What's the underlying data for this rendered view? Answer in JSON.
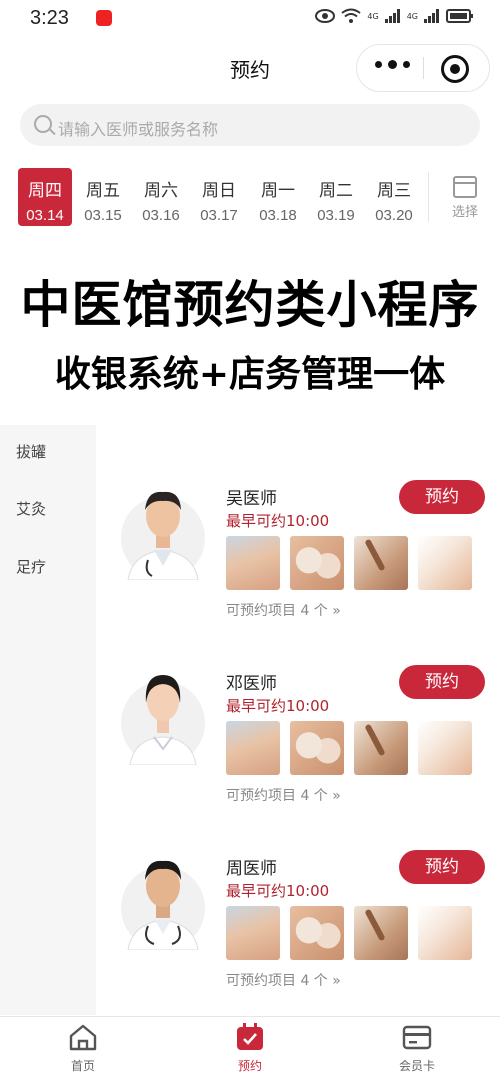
{
  "status_bar": {
    "time": "3:23",
    "signal_label_1": "4G",
    "signal_label_2": "4G"
  },
  "nav": {
    "title": "预约"
  },
  "search": {
    "placeholder": "请输入医师或服务名称"
  },
  "dates": [
    {
      "weekday": "周四",
      "date": "03.14",
      "selected": true
    },
    {
      "weekday": "周五",
      "date": "03.15"
    },
    {
      "weekday": "周六",
      "date": "03.16"
    },
    {
      "weekday": "周日",
      "date": "03.17"
    },
    {
      "weekday": "周一",
      "date": "03.18"
    },
    {
      "weekday": "周二",
      "date": "03.19"
    },
    {
      "weekday": "周三",
      "date": "03.20"
    }
  ],
  "date_picker": {
    "label": "选择"
  },
  "banner": {
    "headline": "中医馆预约类小程序",
    "subheadline": "收银系统+店务管理一体"
  },
  "sidebar": {
    "items": [
      "拔罐",
      "艾灸",
      "足疗"
    ]
  },
  "doctors": [
    {
      "name": "吴医师",
      "earliest": "最早可约10:00",
      "book_label": "预约",
      "items_label": "可预约项目 4 个"
    },
    {
      "name": "邓医师",
      "earliest": "最早可约10:00",
      "book_label": "预约",
      "items_label": "可预约项目 4 个"
    },
    {
      "name": "周医师",
      "earliest": "最早可约10:00",
      "book_label": "预约",
      "items_label": "可预约项目 4 个"
    }
  ],
  "tabbar": {
    "tabs": [
      {
        "label": "首页"
      },
      {
        "label": "预约",
        "active": true
      },
      {
        "label": "会员卡"
      }
    ]
  },
  "colors": {
    "accent": "#c8283a",
    "earliest_text": "#b0232e",
    "sidebar_bg": "#f6f6f6"
  },
  "icons": [
    "search-icon",
    "calendar-icon",
    "home-icon",
    "booking-icon",
    "member-card-icon",
    "more-dots-icon",
    "target-icon"
  ]
}
